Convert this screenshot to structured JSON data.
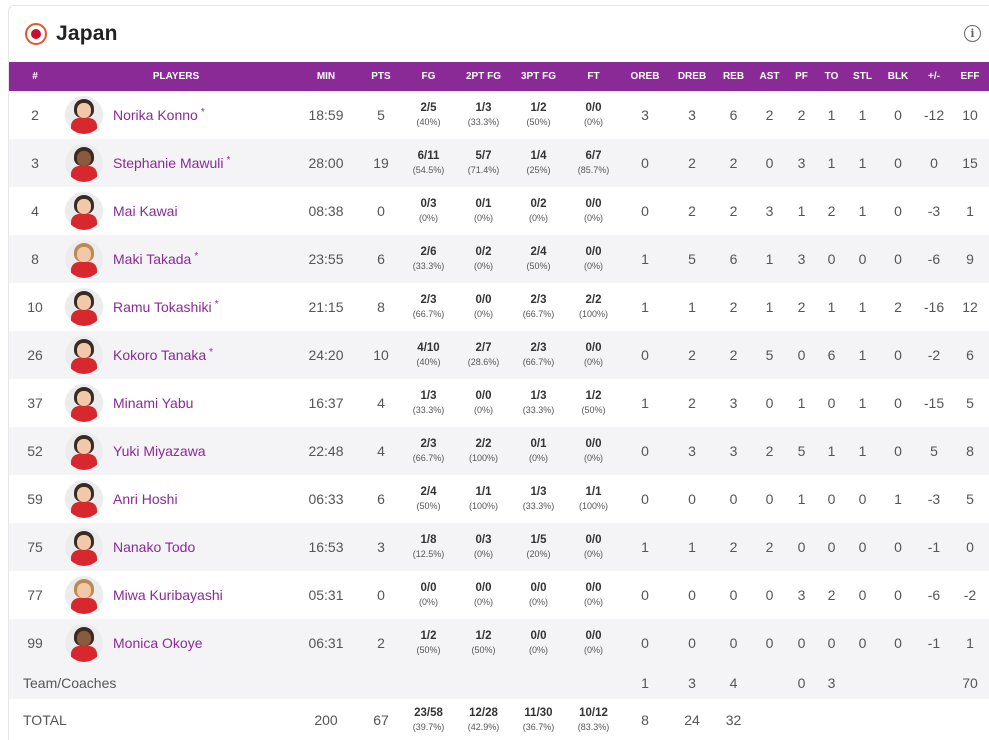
{
  "team": {
    "name": "Japan"
  },
  "columns": [
    "#",
    "PLAYERS",
    "MIN",
    "PTS",
    "FG",
    "2PT FG",
    "3PT FG",
    "FT",
    "OREB",
    "DREB",
    "REB",
    "AST",
    "PF",
    "TO",
    "STL",
    "BLK",
    "+/-",
    "EFF"
  ],
  "players": [
    {
      "no": "2",
      "name": "Norika Konno",
      "starter": "*",
      "min": "18:59",
      "pts": "5",
      "fg": "2/5",
      "fg_pct": "(40%)",
      "fg2": "1/3",
      "fg2_pct": "(33.3%)",
      "fg3": "1/2",
      "fg3_pct": "(50%)",
      "ft": "0/0",
      "ft_pct": "(0%)",
      "oreb": "3",
      "dreb": "3",
      "reb": "6",
      "ast": "2",
      "pf": "2",
      "to": "1",
      "stl": "1",
      "blk": "0",
      "pm": "-12",
      "eff": "10"
    },
    {
      "no": "3",
      "name": "Stephanie Mawuli",
      "starter": "*",
      "min": "28:00",
      "pts": "19",
      "fg": "6/11",
      "fg_pct": "(54.5%)",
      "fg2": "5/7",
      "fg2_pct": "(71.4%)",
      "fg3": "1/4",
      "fg3_pct": "(25%)",
      "ft": "6/7",
      "ft_pct": "(85.7%)",
      "oreb": "0",
      "dreb": "2",
      "reb": "2",
      "ast": "0",
      "pf": "3",
      "to": "1",
      "stl": "1",
      "blk": "0",
      "pm": "0",
      "eff": "15"
    },
    {
      "no": "4",
      "name": "Mai Kawai",
      "starter": "",
      "min": "08:38",
      "pts": "0",
      "fg": "0/3",
      "fg_pct": "(0%)",
      "fg2": "0/1",
      "fg2_pct": "(0%)",
      "fg3": "0/2",
      "fg3_pct": "(0%)",
      "ft": "0/0",
      "ft_pct": "(0%)",
      "oreb": "0",
      "dreb": "2",
      "reb": "2",
      "ast": "3",
      "pf": "1",
      "to": "2",
      "stl": "1",
      "blk": "0",
      "pm": "-3",
      "eff": "1"
    },
    {
      "no": "8",
      "name": "Maki Takada",
      "starter": "*",
      "min": "23:55",
      "pts": "6",
      "fg": "2/6",
      "fg_pct": "(33.3%)",
      "fg2": "0/2",
      "fg2_pct": "(0%)",
      "fg3": "2/4",
      "fg3_pct": "(50%)",
      "ft": "0/0",
      "ft_pct": "(0%)",
      "oreb": "1",
      "dreb": "5",
      "reb": "6",
      "ast": "1",
      "pf": "3",
      "to": "0",
      "stl": "0",
      "blk": "0",
      "pm": "-6",
      "eff": "9"
    },
    {
      "no": "10",
      "name": "Ramu Tokashiki",
      "starter": "*",
      "min": "21:15",
      "pts": "8",
      "fg": "2/3",
      "fg_pct": "(66.7%)",
      "fg2": "0/0",
      "fg2_pct": "(0%)",
      "fg3": "2/3",
      "fg3_pct": "(66.7%)",
      "ft": "2/2",
      "ft_pct": "(100%)",
      "oreb": "1",
      "dreb": "1",
      "reb": "2",
      "ast": "1",
      "pf": "2",
      "to": "1",
      "stl": "1",
      "blk": "2",
      "pm": "-16",
      "eff": "12"
    },
    {
      "no": "26",
      "name": "Kokoro Tanaka",
      "starter": "*",
      "min": "24:20",
      "pts": "10",
      "fg": "4/10",
      "fg_pct": "(40%)",
      "fg2": "2/7",
      "fg2_pct": "(28.6%)",
      "fg3": "2/3",
      "fg3_pct": "(66.7%)",
      "ft": "0/0",
      "ft_pct": "(0%)",
      "oreb": "0",
      "dreb": "2",
      "reb": "2",
      "ast": "5",
      "pf": "0",
      "to": "6",
      "stl": "1",
      "blk": "0",
      "pm": "-2",
      "eff": "6"
    },
    {
      "no": "37",
      "name": "Minami Yabu",
      "starter": "",
      "min": "16:37",
      "pts": "4",
      "fg": "1/3",
      "fg_pct": "(33.3%)",
      "fg2": "0/0",
      "fg2_pct": "(0%)",
      "fg3": "1/3",
      "fg3_pct": "(33.3%)",
      "ft": "1/2",
      "ft_pct": "(50%)",
      "oreb": "1",
      "dreb": "2",
      "reb": "3",
      "ast": "0",
      "pf": "1",
      "to": "0",
      "stl": "1",
      "blk": "0",
      "pm": "-15",
      "eff": "5"
    },
    {
      "no": "52",
      "name": "Yuki Miyazawa",
      "starter": "",
      "min": "22:48",
      "pts": "4",
      "fg": "2/3",
      "fg_pct": "(66.7%)",
      "fg2": "2/2",
      "fg2_pct": "(100%)",
      "fg3": "0/1",
      "fg3_pct": "(0%)",
      "ft": "0/0",
      "ft_pct": "(0%)",
      "oreb": "0",
      "dreb": "3",
      "reb": "3",
      "ast": "2",
      "pf": "5",
      "to": "1",
      "stl": "1",
      "blk": "0",
      "pm": "5",
      "eff": "8"
    },
    {
      "no": "59",
      "name": "Anri Hoshi",
      "starter": "",
      "min": "06:33",
      "pts": "6",
      "fg": "2/4",
      "fg_pct": "(50%)",
      "fg2": "1/1",
      "fg2_pct": "(100%)",
      "fg3": "1/3",
      "fg3_pct": "(33.3%)",
      "ft": "1/1",
      "ft_pct": "(100%)",
      "oreb": "0",
      "dreb": "0",
      "reb": "0",
      "ast": "0",
      "pf": "1",
      "to": "0",
      "stl": "0",
      "blk": "1",
      "pm": "-3",
      "eff": "5"
    },
    {
      "no": "75",
      "name": "Nanako Todo",
      "starter": "",
      "min": "16:53",
      "pts": "3",
      "fg": "1/8",
      "fg_pct": "(12.5%)",
      "fg2": "0/3",
      "fg2_pct": "(0%)",
      "fg3": "1/5",
      "fg3_pct": "(20%)",
      "ft": "0/0",
      "ft_pct": "(0%)",
      "oreb": "1",
      "dreb": "1",
      "reb": "2",
      "ast": "2",
      "pf": "0",
      "to": "0",
      "stl": "0",
      "blk": "0",
      "pm": "-1",
      "eff": "0"
    },
    {
      "no": "77",
      "name": "Miwa Kuribayashi",
      "starter": "",
      "min": "05:31",
      "pts": "0",
      "fg": "0/0",
      "fg_pct": "(0%)",
      "fg2": "0/0",
      "fg2_pct": "(0%)",
      "fg3": "0/0",
      "fg3_pct": "(0%)",
      "ft": "0/0",
      "ft_pct": "(0%)",
      "oreb": "0",
      "dreb": "0",
      "reb": "0",
      "ast": "0",
      "pf": "3",
      "to": "2",
      "stl": "0",
      "blk": "0",
      "pm": "-6",
      "eff": "-2"
    },
    {
      "no": "99",
      "name": "Monica Okoye",
      "starter": "",
      "min": "06:31",
      "pts": "2",
      "fg": "1/2",
      "fg_pct": "(50%)",
      "fg2": "1/2",
      "fg2_pct": "(50%)",
      "fg3": "0/0",
      "fg3_pct": "(0%)",
      "ft": "0/0",
      "ft_pct": "(0%)",
      "oreb": "0",
      "dreb": "0",
      "reb": "0",
      "ast": "0",
      "pf": "0",
      "to": "0",
      "stl": "0",
      "blk": "0",
      "pm": "-1",
      "eff": "1"
    }
  ],
  "team_coaches": {
    "label": "Team/Coaches",
    "oreb": "1",
    "dreb": "3",
    "reb": "4",
    "pf": "0",
    "to": "3",
    "eff": "70"
  },
  "total": {
    "label": "TOTAL",
    "min": "200",
    "pts": "67",
    "fg": "23/58",
    "fg_pct": "(39.7%)",
    "fg2": "12/28",
    "fg2_pct": "(42.9%)",
    "fg3": "11/30",
    "fg3_pct": "(36.7%)",
    "ft": "10/12",
    "ft_pct": "(83.3%)",
    "oreb": "8",
    "dreb": "24",
    "reb": "32"
  },
  "icons": {
    "flag": "japan-flag-icon",
    "info": "info-icon"
  },
  "colors": {
    "header_bg": "#8a2a97",
    "player_link": "#8a2a97",
    "flag_red": "#c8102e"
  }
}
